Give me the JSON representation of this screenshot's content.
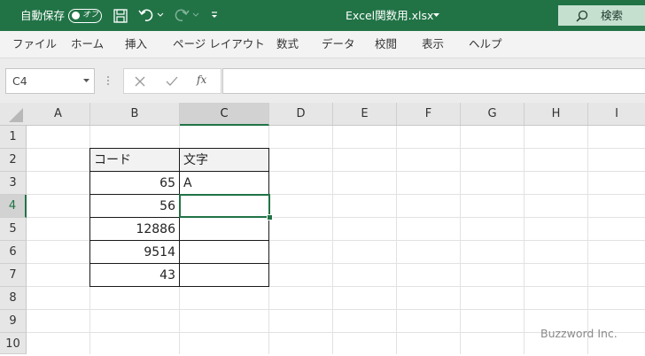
{
  "titlebar": {
    "autosave_label": "自動保存",
    "autosave_state": "オフ",
    "file_title": "Excel関数用.xlsx",
    "search_label": "検索"
  },
  "ribbon": {
    "tabs": [
      "ファイル",
      "ホーム",
      "挿入",
      "ページ レイアウト",
      "数式",
      "データ",
      "校閲",
      "表示",
      "ヘルプ"
    ]
  },
  "formula_bar": {
    "name_box": "C4",
    "fx": "fx",
    "content": ""
  },
  "grid": {
    "columns": [
      "A",
      "B",
      "C",
      "D",
      "E",
      "F",
      "G",
      "H",
      "I"
    ],
    "rows": [
      "1",
      "2",
      "3",
      "4",
      "5",
      "6",
      "7",
      "8",
      "9",
      "10"
    ],
    "selected_cell": "C4",
    "table": {
      "header_b": "コード",
      "header_c": "文字",
      "codes": [
        "65",
        "56",
        "12886",
        "9514",
        "43"
      ],
      "chars": [
        "A",
        "",
        "",
        "",
        ""
      ]
    }
  },
  "watermark": "Buzzword Inc.",
  "colors": {
    "accent": "#217346",
    "ribbon_bg": "#f3f3f3"
  }
}
